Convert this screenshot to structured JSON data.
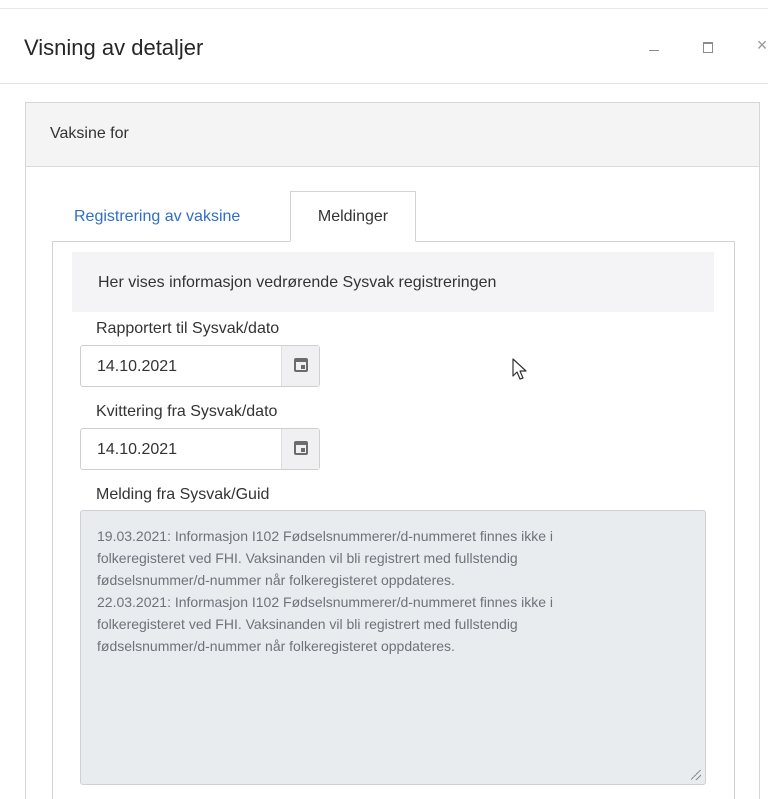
{
  "window": {
    "title": "Visning av detaljer",
    "controls": {
      "minimize_icon": "minimize-icon",
      "maximize_icon": "maximize-icon",
      "close_label": "×"
    }
  },
  "panel": {
    "header": "Vaksine for"
  },
  "tabs": [
    {
      "label": "Registrering av vaksine",
      "active": false
    },
    {
      "label": "Meldinger",
      "active": true
    }
  ],
  "meldinger": {
    "info": "Her vises informasjon vedrørende Sysvak registreringen",
    "rapportert": {
      "label": "Rapportert til Sysvak/dato",
      "value": "14.10.2021",
      "icon": "calendar-icon"
    },
    "kvittering": {
      "label": "Kvittering fra Sysvak/dato",
      "value": "14.10.2021",
      "icon": "calendar-icon"
    },
    "melding": {
      "label": "Melding fra Sysvak/Guid",
      "lines": [
        "19.03.2021: Informasjon I102 Fødselsnummerer/d-nummeret finnes ikke i",
        "folkeregisteret ved FHI. Vaksinanden vil bli registrert med fullstendig",
        "fødselsnummer/d-nummer når folkeregisteret oppdateres.",
        "22.03.2021: Informasjon I102 Fødselsnummerer/d-nummeret finnes ikke i",
        "folkeregisteret ved FHI. Vaksinanden vil bli registrert med fullstendig",
        "fødselsnummer/d-nummer når folkeregisteret oppdateres."
      ]
    }
  },
  "colors": {
    "link": "#2f6fc4",
    "readonly_bg": "#e9ecef",
    "header_bg": "#f4f4f4"
  }
}
